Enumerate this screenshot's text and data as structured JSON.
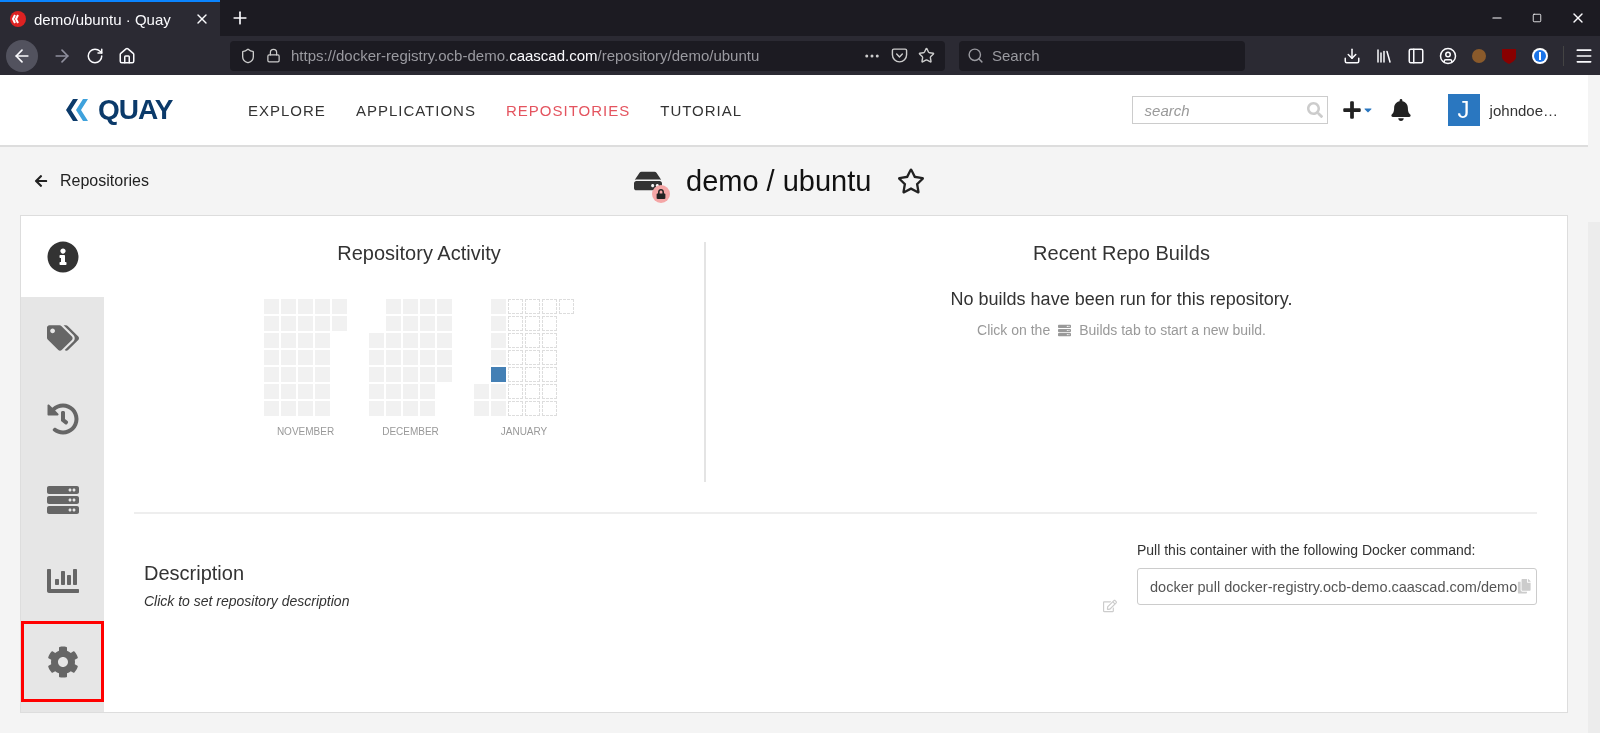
{
  "browser": {
    "tab_title": "demo/ubuntu · Quay",
    "url_start": "https://docker-registry.ocb-demo.",
    "url_domain": "caascad.com",
    "url_end": "/repository/demo/ubuntu",
    "search_placeholder": "Search"
  },
  "header": {
    "logo_text": "QUAY",
    "nav": [
      {
        "label": "EXPLORE",
        "selected": false
      },
      {
        "label": "APPLICATIONS",
        "selected": false
      },
      {
        "label": "REPOSITORIES",
        "selected": true
      },
      {
        "label": "TUTORIAL",
        "selected": false
      }
    ],
    "search_placeholder": "search",
    "avatar_letter": "J",
    "username": "johndoe…"
  },
  "breadcrumb": {
    "back_label": "Repositories"
  },
  "repo": {
    "title": "demo / ubuntu",
    "private": true,
    "starred": false
  },
  "sidebar": {
    "tabs": [
      {
        "kind": "info",
        "selected": true,
        "highlighted": false
      },
      {
        "kind": "tags",
        "selected": false,
        "highlighted": false
      },
      {
        "kind": "history",
        "selected": false,
        "highlighted": false
      },
      {
        "kind": "builds",
        "selected": false,
        "highlighted": false
      },
      {
        "kind": "usage",
        "selected": false,
        "highlighted": false
      },
      {
        "kind": "settings",
        "selected": false,
        "highlighted": true
      }
    ]
  },
  "activity": {
    "title": "Repository Activity",
    "months": [
      {
        "label": "NOVEMBER",
        "weeks": [
          [
            {
              "kind": "empty"
            },
            {
              "kind": "empty"
            },
            {
              "kind": "empty"
            },
            {
              "kind": "empty"
            },
            {
              "kind": "empty"
            },
            {
              "kind": "empty"
            },
            {
              "kind": "empty"
            }
          ],
          [
            {
              "kind": "empty"
            },
            {
              "kind": "empty"
            },
            {
              "kind": "empty"
            },
            {
              "kind": "empty"
            },
            {
              "kind": "empty"
            },
            {
              "kind": "empty"
            },
            {
              "kind": "empty"
            }
          ],
          [
            {
              "kind": "empty"
            },
            {
              "kind": "empty"
            },
            {
              "kind": "empty"
            },
            {
              "kind": "empty"
            },
            {
              "kind": "empty"
            },
            {
              "kind": "empty"
            },
            {
              "kind": "empty"
            }
          ],
          [
            {
              "kind": "empty"
            },
            {
              "kind": "empty"
            },
            {
              "kind": "empty"
            },
            {
              "kind": "empty"
            },
            {
              "kind": "empty"
            },
            {
              "kind": "empty"
            },
            {
              "kind": "empty"
            }
          ],
          [
            {
              "kind": "empty"
            },
            {
              "kind": "empty"
            },
            {
              "kind": "none"
            },
            {
              "kind": "none"
            },
            {
              "kind": "none"
            },
            {
              "kind": "none"
            },
            {
              "kind": "none"
            }
          ]
        ]
      },
      {
        "label": "DECEMBER",
        "weeks": [
          [
            {
              "kind": "none"
            },
            {
              "kind": "none"
            },
            {
              "kind": "empty"
            },
            {
              "kind": "empty"
            },
            {
              "kind": "empty"
            },
            {
              "kind": "empty"
            },
            {
              "kind": "empty"
            }
          ],
          [
            {
              "kind": "empty"
            },
            {
              "kind": "empty"
            },
            {
              "kind": "empty"
            },
            {
              "kind": "empty"
            },
            {
              "kind": "empty"
            },
            {
              "kind": "empty"
            },
            {
              "kind": "empty"
            }
          ],
          [
            {
              "kind": "empty"
            },
            {
              "kind": "empty"
            },
            {
              "kind": "empty"
            },
            {
              "kind": "empty"
            },
            {
              "kind": "empty"
            },
            {
              "kind": "empty"
            },
            {
              "kind": "empty"
            }
          ],
          [
            {
              "kind": "empty"
            },
            {
              "kind": "empty"
            },
            {
              "kind": "empty"
            },
            {
              "kind": "empty"
            },
            {
              "kind": "empty"
            },
            {
              "kind": "empty"
            },
            {
              "kind": "empty"
            }
          ],
          [
            {
              "kind": "empty"
            },
            {
              "kind": "empty"
            },
            {
              "kind": "empty"
            },
            {
              "kind": "empty"
            },
            {
              "kind": "empty"
            },
            {
              "kind": "none"
            },
            {
              "kind": "none"
            }
          ]
        ]
      },
      {
        "label": "JANUARY",
        "weeks": [
          [
            {
              "kind": "none"
            },
            {
              "kind": "none"
            },
            {
              "kind": "none"
            },
            {
              "kind": "none"
            },
            {
              "kind": "none"
            },
            {
              "kind": "empty"
            },
            {
              "kind": "empty"
            }
          ],
          [
            {
              "kind": "empty"
            },
            {
              "kind": "empty"
            },
            {
              "kind": "empty"
            },
            {
              "kind": "empty"
            },
            {
              "kind": "active"
            },
            {
              "kind": "empty"
            },
            {
              "kind": "empty"
            }
          ],
          [
            {
              "kind": "future"
            },
            {
              "kind": "future"
            },
            {
              "kind": "future"
            },
            {
              "kind": "future"
            },
            {
              "kind": "future"
            },
            {
              "kind": "future"
            },
            {
              "kind": "future"
            }
          ],
          [
            {
              "kind": "future"
            },
            {
              "kind": "future"
            },
            {
              "kind": "future"
            },
            {
              "kind": "future"
            },
            {
              "kind": "future"
            },
            {
              "kind": "future"
            },
            {
              "kind": "future"
            }
          ],
          [
            {
              "kind": "future"
            },
            {
              "kind": "future"
            },
            {
              "kind": "future"
            },
            {
              "kind": "future"
            },
            {
              "kind": "future"
            },
            {
              "kind": "future"
            },
            {
              "kind": "future"
            }
          ],
          [
            {
              "kind": "future"
            },
            {
              "kind": "none"
            },
            {
              "kind": "none"
            },
            {
              "kind": "none"
            },
            {
              "kind": "none"
            },
            {
              "kind": "none"
            },
            {
              "kind": "none"
            }
          ]
        ]
      }
    ]
  },
  "builds": {
    "title": "Recent Repo Builds",
    "message": "No builds have been run for this repository.",
    "hint_before": "Click on the",
    "hint_after": "Builds tab to start a new build."
  },
  "description": {
    "title": "Description",
    "placeholder_text": "Click to set repository description"
  },
  "pull": {
    "label": "Pull this container with the following Docker command:",
    "command": "docker pull docker-registry.ocb-demo.caascad.com/demo"
  }
}
